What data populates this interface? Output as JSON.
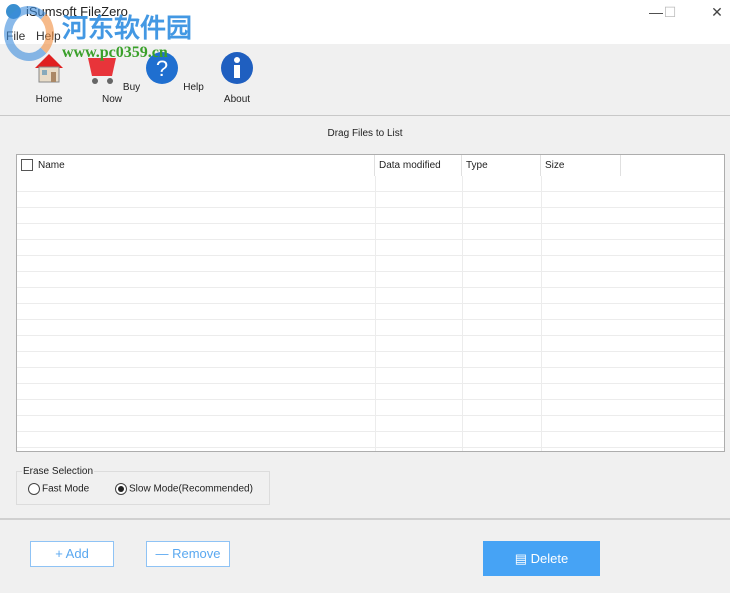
{
  "window": {
    "title": "iSumsoft FileZero",
    "minimize": "—",
    "maximize": "☐",
    "close": "✕"
  },
  "menu": [
    "File",
    "Help"
  ],
  "toolbar": [
    {
      "label": "Home",
      "icon": "home-icon"
    },
    {
      "label": "Buy Now",
      "icon": "cart-icon"
    },
    {
      "label": "Help",
      "icon": "help-icon"
    },
    {
      "label": "About",
      "icon": "info-icon"
    }
  ],
  "drag_text": "Drag Files to List",
  "table": {
    "columns": [
      "Name",
      "Data modified",
      "Type",
      "Size"
    ]
  },
  "erase": {
    "label": "Erase Selection",
    "options": [
      "Fast Mode",
      "Slow Mode(Recommended)"
    ],
    "selected": 1
  },
  "buttons": {
    "add": "+ Add",
    "remove": "— Remove",
    "delete": "Delete"
  },
  "watermark": {
    "cn": "河东软件园",
    "url": "www.pc0359.cn"
  },
  "colors": {
    "accent": "#46a3f5"
  }
}
